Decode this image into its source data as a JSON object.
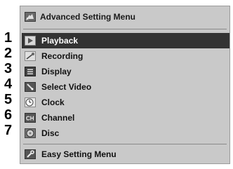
{
  "header": {
    "title": "Advanced Setting Menu",
    "icon": "advanced-setting-icon"
  },
  "callouts": [
    "1",
    "2",
    "3",
    "4",
    "5",
    "6",
    "7"
  ],
  "menu": {
    "items": [
      {
        "label": "Playback",
        "icon": "play-icon",
        "selected": true
      },
      {
        "label": "Recording",
        "icon": "recording-icon",
        "selected": false
      },
      {
        "label": "Display",
        "icon": "display-icon",
        "selected": false
      },
      {
        "label": "Select Video",
        "icon": "select-video-icon",
        "selected": false
      },
      {
        "label": "Clock",
        "icon": "clock-icon",
        "selected": false
      },
      {
        "label": "Channel",
        "icon": "channel-icon",
        "selected": false
      },
      {
        "label": "Disc",
        "icon": "disc-icon",
        "selected": false
      }
    ]
  },
  "footer": {
    "label": "Easy Setting Menu",
    "icon": "wrench-icon"
  },
  "colors": {
    "panel": "#c9c9c9",
    "selected_bg": "#333333",
    "selected_text": "#ffffff",
    "text": "#111111"
  }
}
